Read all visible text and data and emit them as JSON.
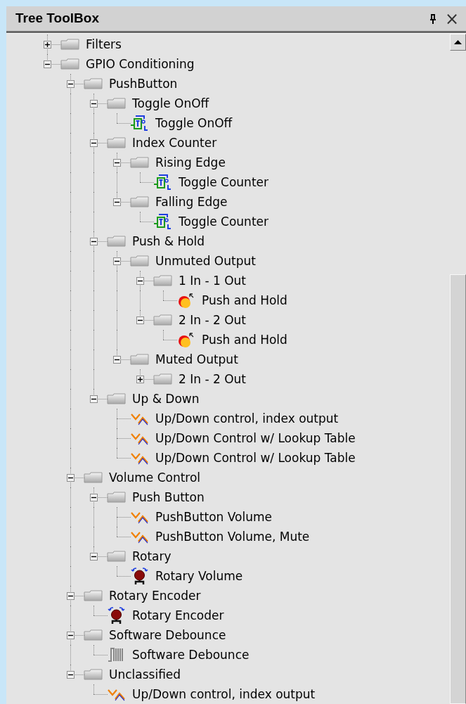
{
  "panel": {
    "title": "Tree ToolBox",
    "close_glyph": "×"
  },
  "tree": [
    {
      "kind": "folder",
      "label": "Filters",
      "expanded": false
    },
    {
      "kind": "folder",
      "label": "GPIO Conditioning",
      "expanded": true,
      "children": [
        {
          "kind": "folder",
          "label": "PushButton",
          "expanded": true,
          "children": [
            {
              "kind": "folder",
              "label": "Toggle OnOff",
              "expanded": true,
              "children": [
                {
                  "kind": "toggle",
                  "label": "Toggle OnOff"
                }
              ]
            },
            {
              "kind": "folder",
              "label": "Index Counter",
              "expanded": true,
              "children": [
                {
                  "kind": "folder",
                  "label": "Rising Edge",
                  "expanded": true,
                  "children": [
                    {
                      "kind": "toggle",
                      "label": "Toggle Counter"
                    }
                  ]
                },
                {
                  "kind": "folder",
                  "label": "Falling Edge",
                  "expanded": true,
                  "children": [
                    {
                      "kind": "toggle",
                      "label": "Toggle Counter"
                    }
                  ]
                }
              ]
            },
            {
              "kind": "folder",
              "label": "Push & Hold",
              "expanded": true,
              "children": [
                {
                  "kind": "folder",
                  "label": "Unmuted Output",
                  "expanded": true,
                  "children": [
                    {
                      "kind": "folder",
                      "label": "1 In - 1 Out",
                      "expanded": true,
                      "children": [
                        {
                          "kind": "pushhold",
                          "label": "Push and Hold"
                        }
                      ]
                    },
                    {
                      "kind": "folder",
                      "label": "2 In - 2 Out",
                      "expanded": true,
                      "children": [
                        {
                          "kind": "pushhold",
                          "label": "Push and Hold"
                        }
                      ]
                    }
                  ]
                },
                {
                  "kind": "folder",
                  "label": "Muted Output",
                  "expanded": true,
                  "children": [
                    {
                      "kind": "folder",
                      "label": "2 In - 2 Out",
                      "expanded": false
                    }
                  ]
                }
              ]
            },
            {
              "kind": "folder",
              "label": "Up & Down",
              "expanded": true,
              "children": [
                {
                  "kind": "updown",
                  "label": "Up/Down control, index output"
                },
                {
                  "kind": "updown",
                  "label": "Up/Down Control w/ Lookup Table"
                },
                {
                  "kind": "updown",
                  "label": "Up/Down Control w/ Lookup Table"
                }
              ]
            }
          ]
        },
        {
          "kind": "folder",
          "label": "Volume Control",
          "expanded": true,
          "children": [
            {
              "kind": "folder",
              "label": "Push Button",
              "expanded": true,
              "children": [
                {
                  "kind": "updown",
                  "label": "PushButton Volume"
                },
                {
                  "kind": "updown",
                  "label": "PushButton Volume, Mute"
                }
              ]
            },
            {
              "kind": "folder",
              "label": "Rotary",
              "expanded": true,
              "children": [
                {
                  "kind": "rotary",
                  "label": "Rotary Volume"
                }
              ]
            }
          ]
        },
        {
          "kind": "folder",
          "label": "Rotary Encoder",
          "expanded": true,
          "children": [
            {
              "kind": "rotary",
              "label": "Rotary Encoder"
            }
          ]
        },
        {
          "kind": "folder",
          "label": "Software Debounce",
          "expanded": true,
          "children": [
            {
              "kind": "debounce",
              "label": "Software Debounce"
            }
          ]
        },
        {
          "kind": "folder",
          "label": "Unclassified",
          "expanded": true,
          "children": [
            {
              "kind": "updown",
              "label": "Up/Down control, index output"
            }
          ]
        }
      ]
    }
  ]
}
